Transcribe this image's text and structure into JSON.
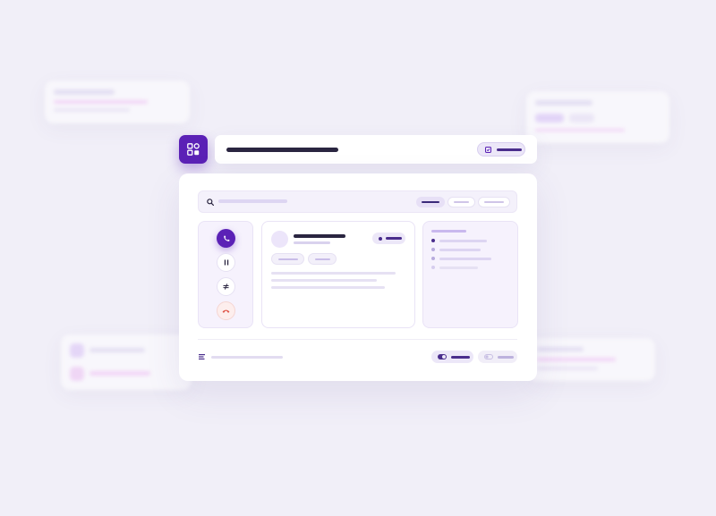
{
  "colors": {
    "background": "#f1eff8",
    "accent": "#5b21b6",
    "accent_light": "#ece7f8",
    "danger": "#e0574a",
    "text_dark": "#2a2540"
  },
  "app": {
    "logo_icon": "grid-apps-icon"
  },
  "title_bar": {
    "title": "",
    "verify_icon": "checkbox-icon",
    "verify_label": ""
  },
  "search": {
    "icon": "search-icon",
    "placeholder": "",
    "segments": [
      "",
      "",
      ""
    ]
  },
  "call_controls": [
    {
      "icon": "phone-icon",
      "label": ""
    },
    {
      "icon": "pause-icon",
      "label": ""
    },
    {
      "icon": "not-equal-icon",
      "label": ""
    },
    {
      "icon": "hang-up-icon",
      "label": ""
    }
  ],
  "contact": {
    "name": "",
    "subtitle": "",
    "status": "",
    "tags": [
      "",
      ""
    ]
  },
  "agenda": {
    "heading": "",
    "items": [
      "",
      "",
      "",
      ""
    ]
  },
  "footer": {
    "menu_icon": "lines-icon",
    "status_text": "",
    "toggle_on_label": "",
    "toggle_off_label": ""
  }
}
